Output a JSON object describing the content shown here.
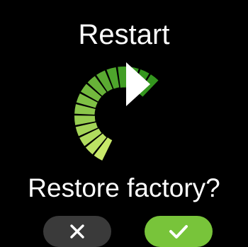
{
  "screen": {
    "title": "Restart",
    "question": "Restore factory?",
    "graphic_icon": "restart-arrow-icon",
    "colors": {
      "background": "#000000",
      "text": "#ffffff",
      "accent_green": "#78c43a",
      "cancel_bg": "#3a3a3a"
    }
  },
  "buttons": {
    "cancel": {
      "icon": "close-icon"
    },
    "confirm": {
      "icon": "check-icon"
    }
  }
}
